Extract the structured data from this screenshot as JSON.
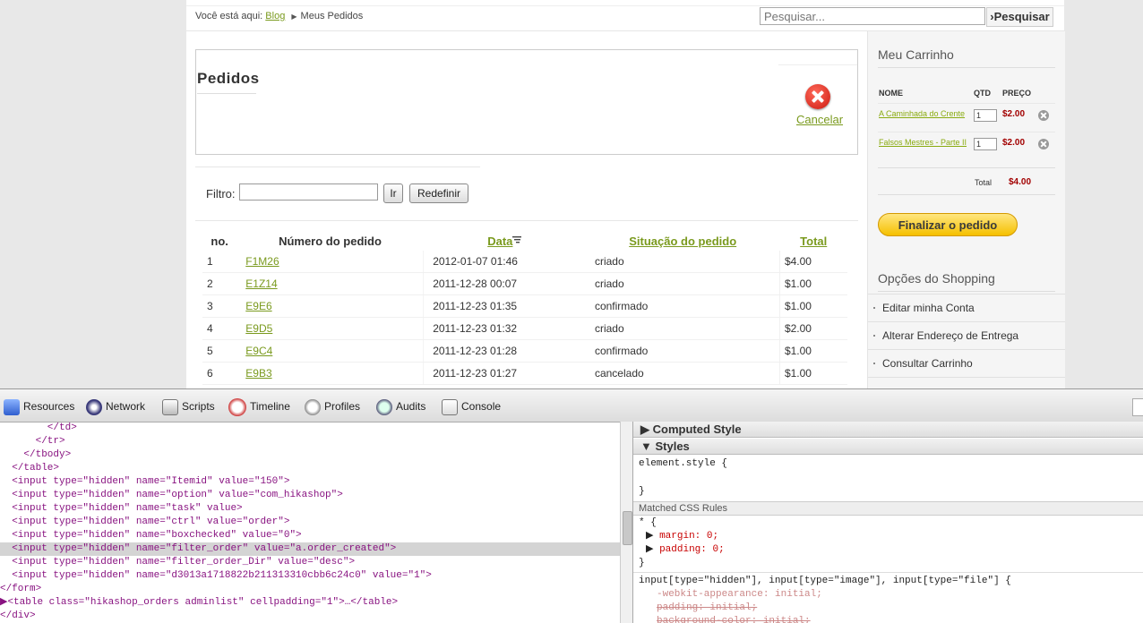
{
  "breadcrumb": {
    "prefix": "Você está aqui:",
    "link": "Blog",
    "current": "Meus Pedidos"
  },
  "search": {
    "placeholder": "Pesquisar...",
    "button": "›Pesquisar"
  },
  "orders": {
    "title": "Pedidos",
    "cancel_label": "Cancelar",
    "filter_label": "Filtro:",
    "go_label": "Ir",
    "reset_label": "Redefinir",
    "columns": {
      "no": "no.",
      "number": "Número do pedido",
      "date": "Data",
      "status": "Situação do pedido",
      "total": "Total"
    },
    "rows": [
      {
        "no": "1",
        "number": "F1M26",
        "date": "2012-01-07 01:46",
        "status": "criado",
        "total": "$4.00"
      },
      {
        "no": "2",
        "number": "E1Z14",
        "date": "2011-12-28 00:07",
        "status": "criado",
        "total": "$1.00"
      },
      {
        "no": "3",
        "number": "E9E6",
        "date": "2011-12-23 01:35",
        "status": "confirmado",
        "total": "$1.00"
      },
      {
        "no": "4",
        "number": "E9D5",
        "date": "2011-12-23 01:32",
        "status": "criado",
        "total": "$2.00"
      },
      {
        "no": "5",
        "number": "E9C4",
        "date": "2011-12-23 01:28",
        "status": "confirmado",
        "total": "$1.00"
      },
      {
        "no": "6",
        "number": "E9B3",
        "date": "2011-12-23 01:27",
        "status": "cancelado",
        "total": "$1.00"
      }
    ]
  },
  "cart": {
    "title": "Meu Carrinho",
    "columns": {
      "name": "NOME",
      "qty": "QTD",
      "price": "PREÇO"
    },
    "items": [
      {
        "name": "A Caminhada do Crente",
        "qty": "1",
        "price": "$2.00"
      },
      {
        "name": "Falsos Mestres - Parte II",
        "qty": "1",
        "price": "$2.00"
      }
    ],
    "total_label": "Total",
    "total_value": "$4.00",
    "checkout_label": "Finalizar o pedido"
  },
  "shopping": {
    "title": "Opções do Shopping",
    "items": [
      "Editar minha Conta",
      "Alterar Endereço de Entrega",
      "Consultar Carrinho"
    ]
  },
  "devtools": {
    "tabs": [
      "Resources",
      "Network",
      "Scripts",
      "Timeline",
      "Profiles",
      "Audits",
      "Console"
    ],
    "dom_lines": [
      "        </td>",
      "      </tr>",
      "    </tbody>",
      "  </table>",
      "  <input type=\"hidden\" name=\"Itemid\" value=\"150\">",
      "  <input type=\"hidden\" name=\"option\" value=\"com_hikashop\">",
      "  <input type=\"hidden\" name=\"task\" value>",
      "  <input type=\"hidden\" name=\"ctrl\" value=\"order\">",
      "  <input type=\"hidden\" name=\"boxchecked\" value=\"0\">",
      "  <input type=\"hidden\" name=\"filter_order\" value=\"a.order_created\">",
      "  <input type=\"hidden\" name=\"filter_order_Dir\" value=\"desc\">",
      "  <input type=\"hidden\" name=\"d3013a1718822b211313310cbb6c24c0\" value=\"1\">",
      "</form>",
      "▶<table class=\"hikashop_orders adminlist\" cellpadding=\"1\">…</table>",
      "</div>"
    ],
    "computed_label": "Computed Style",
    "styles_label": "Styles",
    "element_style_open": "element.style {",
    "element_style_close": "}",
    "matched_label": "Matched CSS Rules",
    "rule1_selector": "* {",
    "rule1_props": [
      "margin: 0;",
      "padding: 0;"
    ],
    "rule1_close": "}",
    "rule2_selector": "input[type=\"hidden\"], input[type=\"image\"], input[type=\"file\"] {",
    "rule2_props": [
      "-webkit-appearance: initial;",
      "padding: initial;",
      "background-color: initial;"
    ]
  },
  "colors": {
    "link": "#7a9a1e",
    "price": "#a20000",
    "checkout": "#f5c000",
    "cancel_icon": "#cc1a10"
  }
}
